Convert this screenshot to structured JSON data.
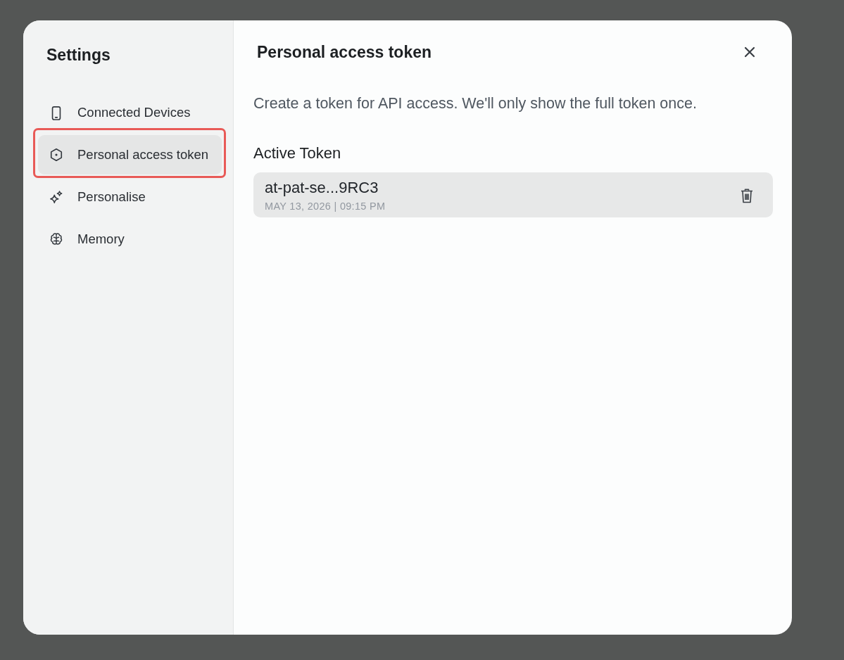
{
  "sidebar": {
    "title": "Settings",
    "items": [
      {
        "label": "Connected Devices",
        "selected": false,
        "highlighted": false
      },
      {
        "label": "Personal access token",
        "selected": true,
        "highlighted": true
      },
      {
        "label": "Personalise",
        "selected": false,
        "highlighted": false
      },
      {
        "label": "Memory",
        "selected": false,
        "highlighted": false
      }
    ]
  },
  "panel": {
    "title": "Personal access token",
    "description": "Create a token for API access. We'll only show the full token once.",
    "section_title": "Active Token",
    "tokens": [
      {
        "name": "at-pat-se...9RC3",
        "created": "MAY 13, 2026 | 09:15 PM"
      }
    ]
  }
}
